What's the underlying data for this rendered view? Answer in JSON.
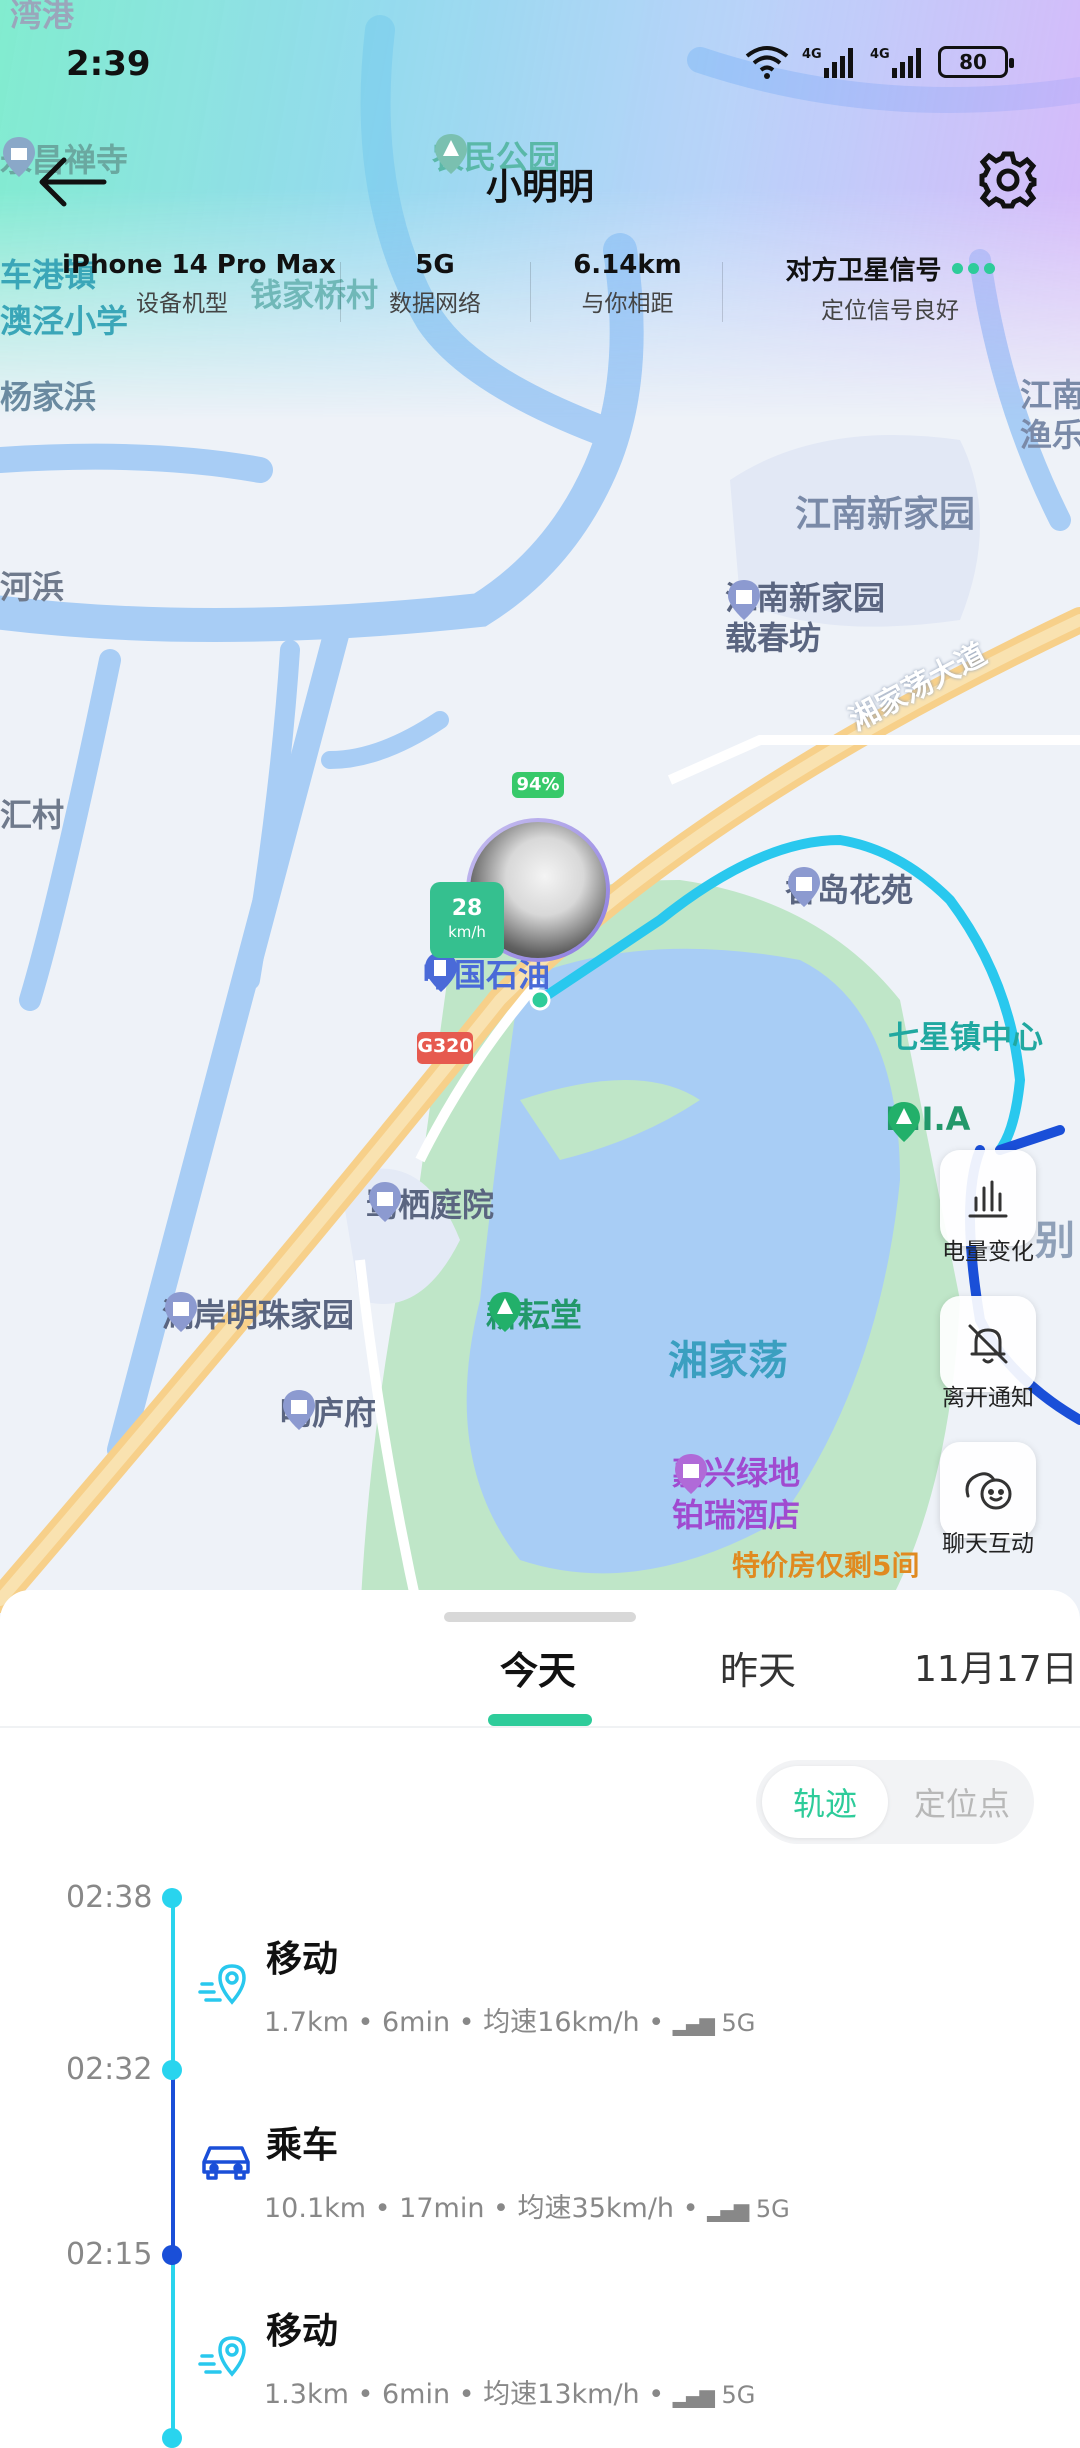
{
  "status_bar": {
    "time": "2:39",
    "battery": "80"
  },
  "header": {
    "title": "小明明"
  },
  "info": [
    {
      "value": "iPhone 14 Pro Max",
      "label": "设备机型"
    },
    {
      "value": "5G",
      "label": "数据网络"
    },
    {
      "value": "6.14km",
      "label": "与你相距"
    },
    {
      "value": "对方卫星信号",
      "label": "定位信号良好"
    }
  ],
  "map": {
    "labels": [
      "湾港",
      "永昌禅寺",
      "农民公园",
      "车港镇",
      "澳泾小学",
      "钱家桥村",
      "杨家浜",
      "江南新家园",
      "河浜",
      "汇村",
      "湘家荡大道",
      "七星镇中心",
      "湘家荡",
      "别",
      "江南",
      "渔乐"
    ],
    "pois": [
      "江南新家园载春坊",
      "香岛花苑",
      "中国石油",
      "鹭栖庭院",
      "湖岸明珠家园",
      "耕耘堂",
      "鸣庐府",
      "B.I.A",
      "嘉兴绿地铂瑞酒店"
    ],
    "poi_line2": {
      "jiangnan": "载春坊",
      "hotel": "铂瑞酒店"
    },
    "poi_line1": {
      "jiangnan": "江南新家园",
      "hotel": "嘉兴绿地"
    },
    "hotel_promo": "特价房仅剩5间",
    "road_badge": "G320",
    "battery_badge": "94%",
    "speed": "28",
    "speed_unit": "km/h"
  },
  "side_actions": [
    {
      "label": "电量变化",
      "icon": "bar-chart-icon"
    },
    {
      "label": "离开通知",
      "icon": "bell-off-icon"
    },
    {
      "label": "聊天互动",
      "icon": "chat-icon"
    }
  ],
  "tabs": [
    "今天",
    "昨天",
    "11月17日"
  ],
  "segment": {
    "track": "轨迹",
    "points": "定位点"
  },
  "timeline": [
    {
      "time": "02:38",
      "title": "移动",
      "distance": "1.7km",
      "duration": "6min",
      "speed": "均速16km/h",
      "net": "5G",
      "icon": "walk-pin-icon"
    },
    {
      "time": "02:32",
      "title": "乘车",
      "distance": "10.1km",
      "duration": "17min",
      "speed": "均速35km/h",
      "net": "5G",
      "icon": "car-icon"
    },
    {
      "time": "02:15",
      "title": "移动",
      "distance": "1.3km",
      "duration": "6min",
      "speed": "均速13km/h",
      "net": "5G",
      "icon": "walk-pin-icon"
    }
  ],
  "colors": {
    "accent": "#2ecc9a",
    "track": "#29c8ee",
    "route_dark": "#1a4fd8",
    "water": "#a8cdf5"
  }
}
